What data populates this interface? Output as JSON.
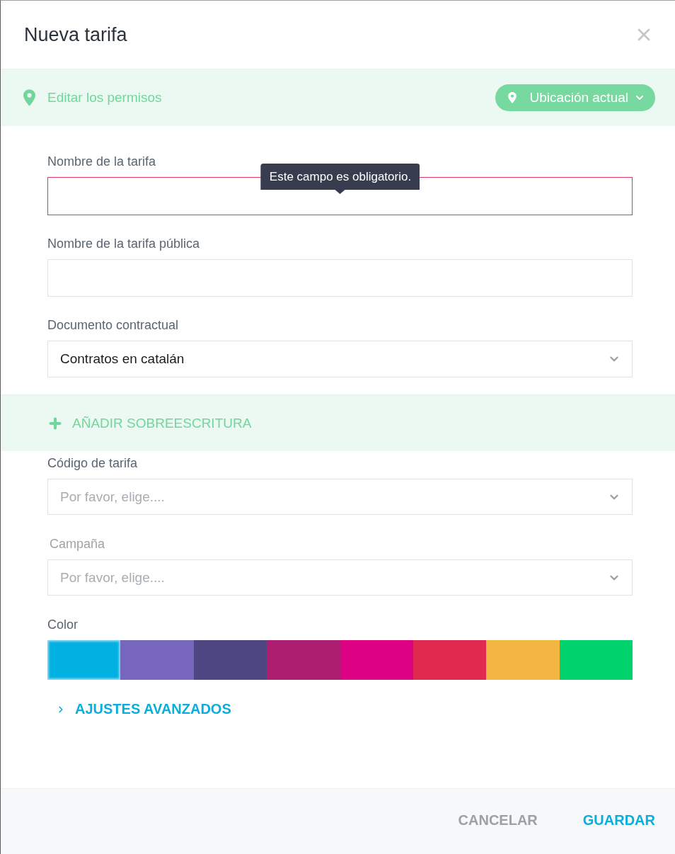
{
  "dialog": {
    "title": "Nueva tarifa"
  },
  "permissions_bar": {
    "label": "Editar los permisos",
    "location_button": "Ubicación actual"
  },
  "fields": [
    {
      "kind": "text",
      "label": "Nombre de la tarifa",
      "invalid": true,
      "error": "Este campo es obligatorio."
    },
    {
      "kind": "text",
      "label": "Nombre de la tarifa pública",
      "invalid": false
    },
    {
      "kind": "select",
      "label": "Documento contractual",
      "value": "Contratos en catalán"
    }
  ],
  "override_button": "AÑADIR SOBREESCRITURA",
  "override_fields": [
    {
      "kind": "select",
      "label": "Código de tarifa",
      "placeholder": "Por favor, elige....",
      "disabled": false
    },
    {
      "kind": "select",
      "label": "Campaña",
      "placeholder": "Por favor, elige....",
      "disabled": true
    }
  ],
  "color_picker": {
    "label": "Color",
    "swatches": [
      {
        "color": "#00b0e0",
        "selected": true
      },
      {
        "color": "#7667bd",
        "selected": false
      },
      {
        "color": "#4d4680",
        "selected": false
      },
      {
        "color": "#ab1e6f",
        "selected": false
      },
      {
        "color": "#dc0083",
        "selected": false
      },
      {
        "color": "#e0294f",
        "selected": false
      },
      {
        "color": "#f4b642",
        "selected": false
      },
      {
        "color": "#00d36d",
        "selected": false
      }
    ]
  },
  "advanced_settings": {
    "label": "AJUSTES AVANZADOS",
    "expanded": false
  },
  "footer": {
    "buttons": [
      {
        "kind": "secondary",
        "label": "CANCELAR"
      },
      {
        "kind": "primary",
        "label": "GUARDAR"
      }
    ]
  }
}
